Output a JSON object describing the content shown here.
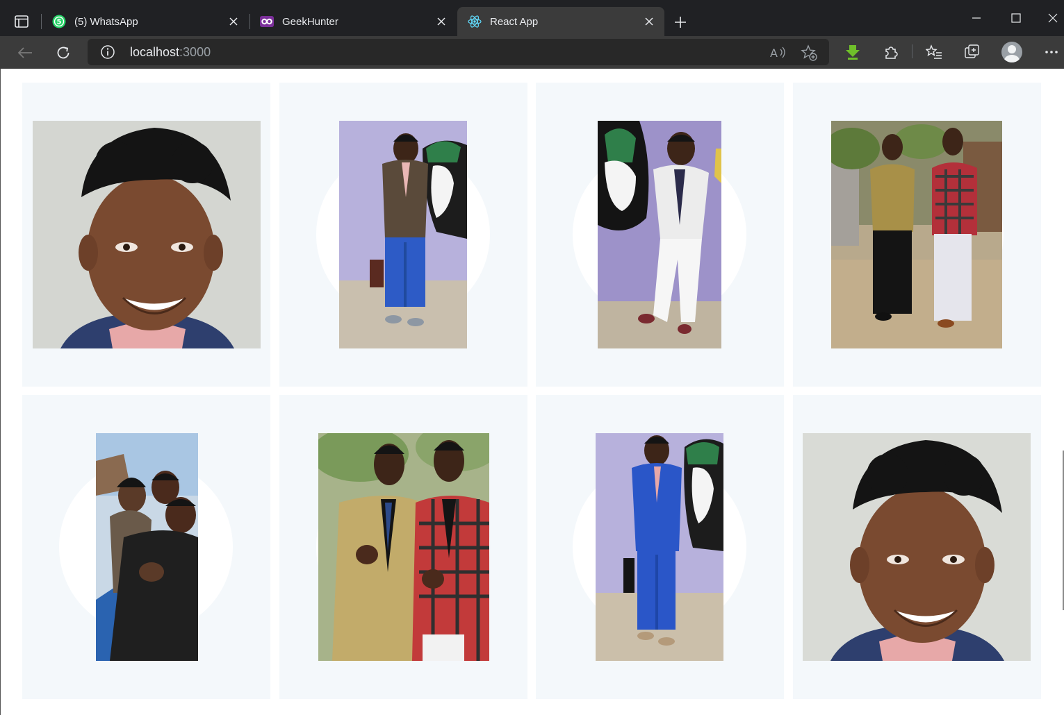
{
  "browser": {
    "tabs": [
      {
        "title": "(5) WhatsApp",
        "icon": "whatsapp-icon",
        "badge": "5"
      },
      {
        "title": "GeekHunter",
        "icon": "geekhunter-icon"
      },
      {
        "title": "React App",
        "icon": "react-icon",
        "active": true
      }
    ],
    "address": {
      "host": "localhost",
      "port": ":3000"
    }
  },
  "gallery": {
    "photos": [
      {
        "subject": "portrait-close-up"
      },
      {
        "subject": "man-in-brown-double-breasted-suit"
      },
      {
        "subject": "man-in-white-blazer"
      },
      {
        "subject": "two-men-in-blazers"
      },
      {
        "subject": "group-selfie"
      },
      {
        "subject": "two-men-posing"
      },
      {
        "subject": "man-in-blue-suit"
      },
      {
        "subject": "portrait-close-up"
      }
    ]
  },
  "colors": {
    "card_bg": "#f4f8fb",
    "tab_strip": "#202124",
    "toolbar": "#3b3b3b"
  }
}
